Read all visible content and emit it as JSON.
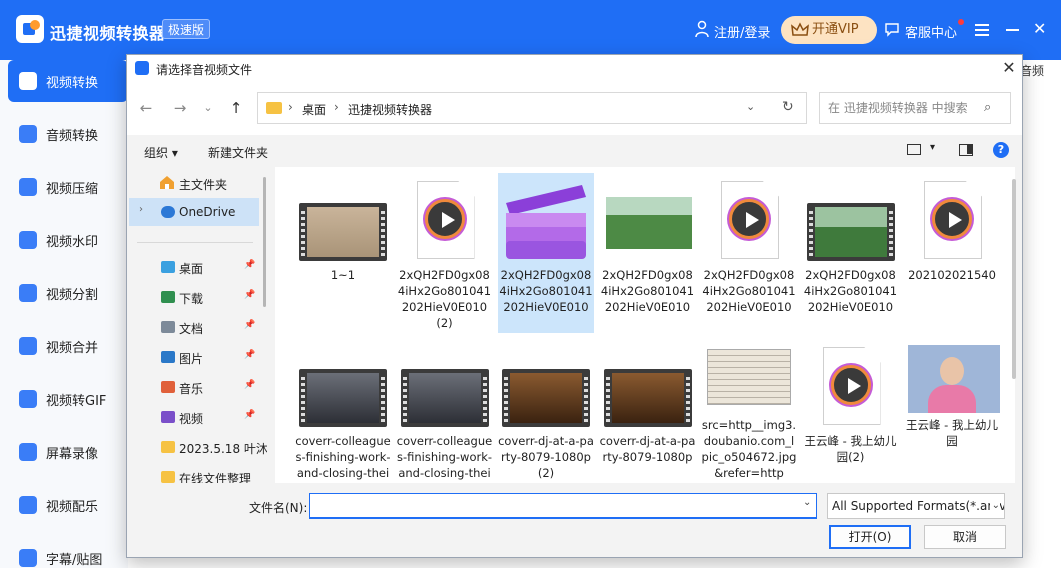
{
  "app": {
    "title": "迅捷视频转换器",
    "edition": "极速版",
    "login": "注册/登录",
    "vip": "开通VIP",
    "service": "客服中心",
    "tab_peek": "音频"
  },
  "sidebar": {
    "items": [
      {
        "label": "视频转换",
        "icon": "video-convert-icon"
      },
      {
        "label": "音频转换",
        "icon": "audio-convert-icon"
      },
      {
        "label": "视频压缩",
        "icon": "video-compress-icon"
      },
      {
        "label": "视频水印",
        "icon": "video-watermark-icon"
      },
      {
        "label": "视频分割",
        "icon": "video-split-icon"
      },
      {
        "label": "视频合并",
        "icon": "video-merge-icon"
      },
      {
        "label": "视频转GIF",
        "icon": "video-gif-icon"
      },
      {
        "label": "屏幕录像",
        "icon": "screen-record-icon"
      },
      {
        "label": "视频配乐",
        "icon": "video-music-icon"
      },
      {
        "label": "字幕/贴图",
        "icon": "subtitle-icon"
      }
    ]
  },
  "dialog": {
    "title": "请选择音视频文件",
    "breadcrumb": [
      "桌面",
      "迅捷视频转换器"
    ],
    "search_placeholder": "在 迅捷视频转换器 中搜索",
    "organize": "组织 ▾",
    "new_folder": "新建文件夹",
    "nav": {
      "home": "主文件夹",
      "onedrive": "OneDrive",
      "quick": [
        {
          "label": "桌面",
          "icon": "desktop-icon",
          "color": "#3aa0e0"
        },
        {
          "label": "下载",
          "icon": "download-icon",
          "color": "#2f8f4f"
        },
        {
          "label": "文档",
          "icon": "document-icon",
          "color": "#7d8a99"
        },
        {
          "label": "图片",
          "icon": "picture-icon",
          "color": "#2a78c8"
        },
        {
          "label": "音乐",
          "icon": "music-icon",
          "color": "#e0603a"
        },
        {
          "label": "视频",
          "icon": "video-icon",
          "color": "#7a4fc9"
        },
        {
          "label": "2023.5.18 叶沐",
          "icon": "folder-icon",
          "color": "#f6c243"
        },
        {
          "label": "在线文件整理",
          "icon": "folder-icon",
          "color": "#f6c243"
        }
      ]
    },
    "files": [
      {
        "name": "1~1",
        "thumb": "film-desert"
      },
      {
        "name": "2xQH2FD0gx084iHx2Go801041202HieV0E010(2)",
        "thumb": "media-play"
      },
      {
        "name": "2xQH2FD0gx084iHx2Go801041202HieV0E010",
        "thumb": "clapper",
        "selected": true
      },
      {
        "name": "2xQH2FD0gx084iHx2Go801041202HieV0E010",
        "thumb": "photo-field"
      },
      {
        "name": "2xQH2FD0gx084iHx2Go801041202HieV0E010",
        "thumb": "media-play"
      },
      {
        "name": "2xQH2FD0gx084iHx2Go801041202HieV0E010",
        "thumb": "film-field"
      },
      {
        "name": "202102021540",
        "thumb": "media-play"
      },
      {
        "name": "coverr-colleagues-finishing-work-and-closing-their-laptops",
        "thumb": "film-office"
      },
      {
        "name": "coverr-colleagues-finishing-work-and-closing-their-laptops",
        "thumb": "film-office"
      },
      {
        "name": "coverr-dj-at-a-party-8079-1080p(2)",
        "thumb": "film-party"
      },
      {
        "name": "coverr-dj-at-a-party-8079-1080p",
        "thumb": "film-party"
      },
      {
        "name": "src=http__img3.doubanio.com_lpic_o504672.jpg&refer=http",
        "thumb": "photo-book"
      },
      {
        "name": "王云峰 - 我上幼儿园(2)",
        "thumb": "media-play"
      },
      {
        "name": "王云峰 - 我上幼儿园",
        "thumb": "photo-portrait"
      }
    ],
    "filename_label": "文件名(N):",
    "filename_value": "",
    "filetype": "All Supported Formats(*.amv",
    "open": "打开(O)",
    "cancel": "取消"
  },
  "colors": {
    "brand": "#1f6ef5",
    "vip_bg": "#fde3c2",
    "selection": "#cce5fb"
  }
}
